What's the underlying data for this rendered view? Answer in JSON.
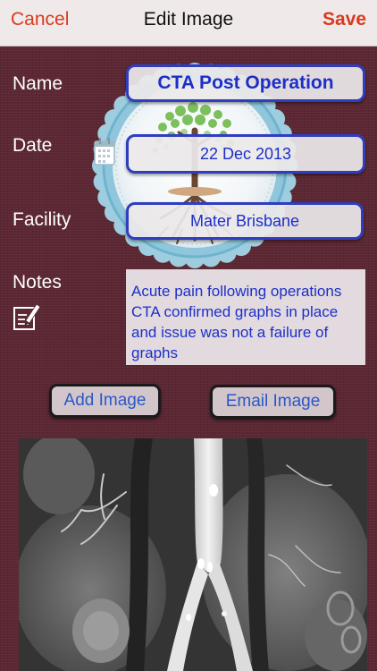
{
  "navbar": {
    "cancel_label": "Cancel",
    "title": "Edit Image",
    "save_label": "Save"
  },
  "form": {
    "name_label": "Name",
    "name_value": "CTA Post Operation",
    "date_label": "Date",
    "date_value": "22 Dec 2013",
    "facility_label": "Facility",
    "facility_value": "Mater Brisbane",
    "notes_label": "Notes",
    "notes_value": "Acute pain following operations CTA confirmed graphs in place and issue was not a failure of graphs"
  },
  "buttons": {
    "add_image_label": "Add Image",
    "email_image_label": "Email Image"
  },
  "icons": {
    "calendar": "calendar-icon",
    "notes": "edit-notes-icon"
  },
  "colors": {
    "accent_red": "#d93a1e",
    "field_text_blue": "#1c2fc9",
    "field_border": "#2f3dbf",
    "background_maroon": "#5b2733"
  }
}
